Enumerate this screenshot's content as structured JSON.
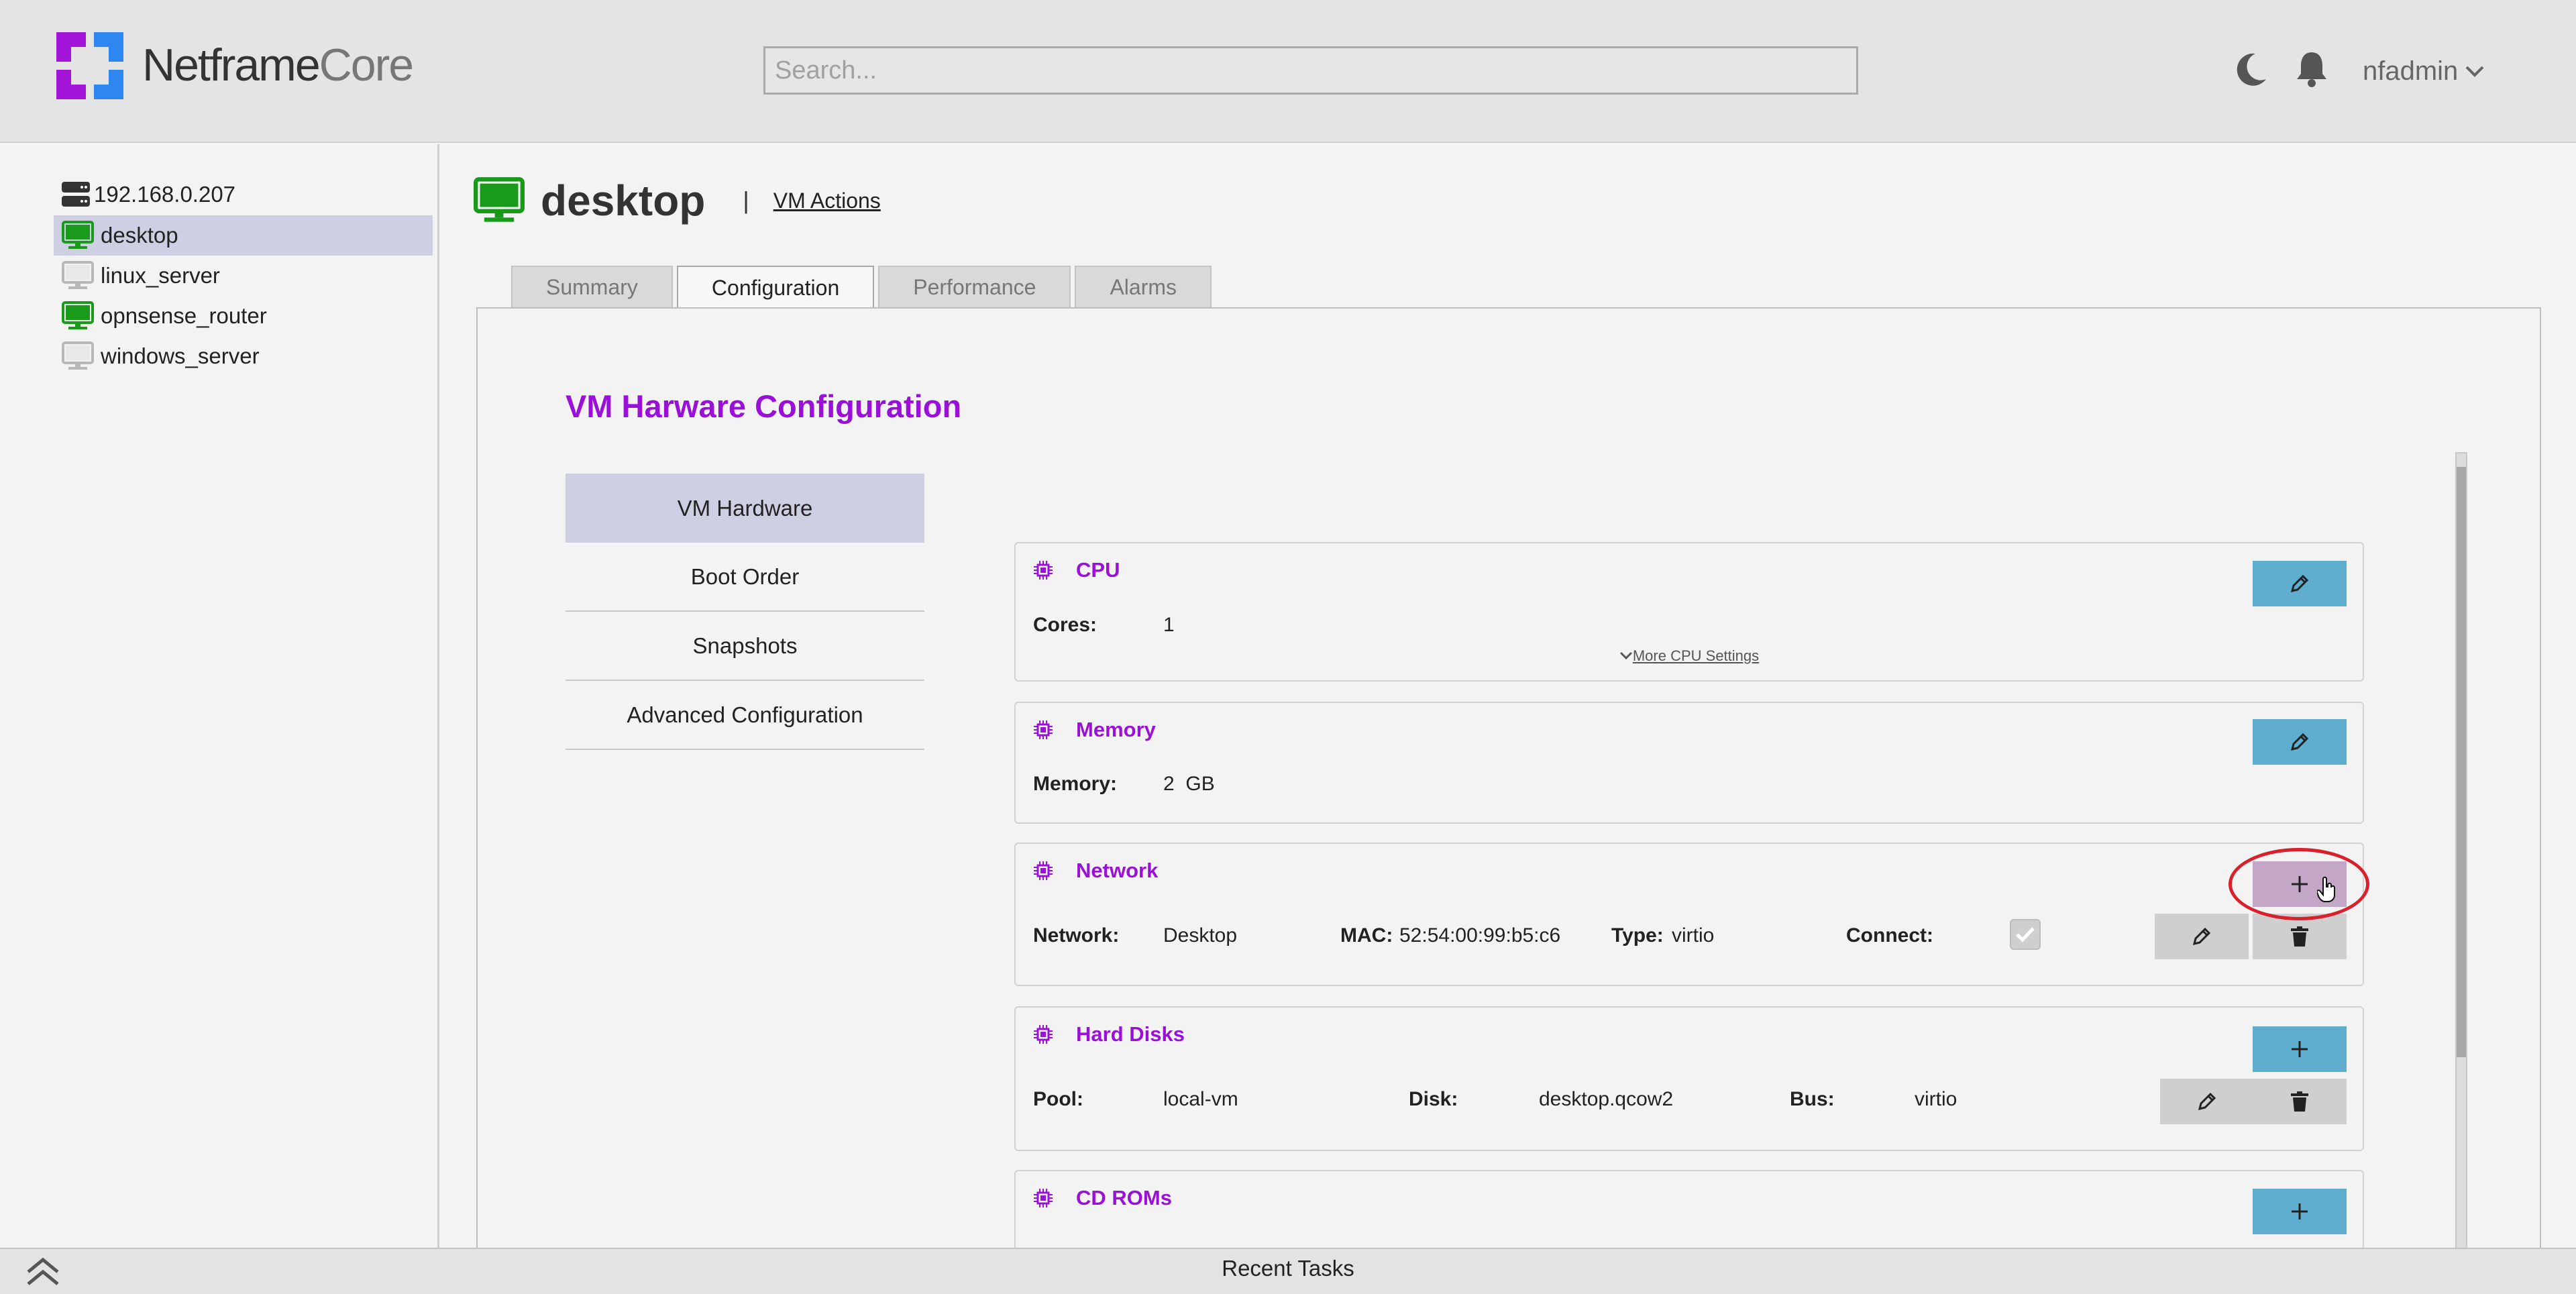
{
  "app": {
    "brand_main": "Netframe",
    "brand_accent": "Core"
  },
  "header": {
    "search_placeholder": "Search...",
    "username": "nfadmin"
  },
  "sidebar": {
    "items": [
      {
        "label": "192.168.0.207",
        "icon": "server-icon"
      },
      {
        "label": "desktop",
        "icon": "monitor-icon",
        "status": "running"
      },
      {
        "label": "linux_server",
        "icon": "monitor-icon",
        "status": "stopped"
      },
      {
        "label": "opnsense_router",
        "icon": "monitor-icon",
        "status": "running"
      },
      {
        "label": "windows_server",
        "icon": "monitor-icon",
        "status": "stopped"
      }
    ]
  },
  "vm": {
    "name": "desktop",
    "separator": "|",
    "actions_label": "VM Actions"
  },
  "tabs": [
    {
      "label": "Summary"
    },
    {
      "label": "Configuration",
      "active": true
    },
    {
      "label": "Performance"
    },
    {
      "label": "Alarms"
    }
  ],
  "config": {
    "title": "VM Harware Configuration",
    "menu": [
      {
        "label": "VM Hardware",
        "active": true
      },
      {
        "label": "Boot Order"
      },
      {
        "label": "Snapshots"
      },
      {
        "label": "Advanced Configuration"
      }
    ],
    "cpu": {
      "title": "CPU",
      "cores_label": "Cores:",
      "cores_value": "1",
      "more_link": "More CPU Settings"
    },
    "memory": {
      "title": "Memory",
      "label": "Memory:",
      "value": "2  GB"
    },
    "network": {
      "title": "Network",
      "network_label": "Network:",
      "network_value": "Desktop",
      "mac_label": "MAC:",
      "mac_value": "52:54:00:99:b5:c6",
      "type_label": "Type:",
      "type_value": "virtio",
      "connect_label": "Connect:"
    },
    "hard_disks": {
      "title": "Hard Disks",
      "pool_label": "Pool:",
      "pool_value": "local-vm",
      "disk_label": "Disk:",
      "disk_value": "desktop.qcow2",
      "bus_label": "Bus:",
      "bus_value": "virtio"
    },
    "cd_roms": {
      "title": "CD ROMs"
    }
  },
  "footer": {
    "recent_tasks": "Recent Tasks"
  },
  "colors": {
    "accent_purple": "#9b10d8",
    "button_blue": "#5faecf",
    "vm_running_green": "#1a9a1a",
    "vm_stopped_grey": "#b8b8b8",
    "highlight_red": "#d9202b"
  }
}
